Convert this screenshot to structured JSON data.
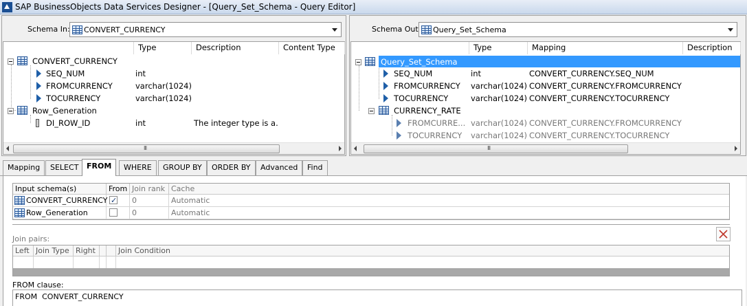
{
  "window": {
    "title": "SAP BusinessObjects Data Services Designer - [Query_Set_Schema - Query Editor]"
  },
  "schema_in": {
    "label": "Schema In:",
    "selected": "CONVERT_CURRENCY",
    "columns": [
      "Type",
      "Description",
      "Content Type"
    ],
    "tree": [
      {
        "name": "CONVERT_CURRENCY",
        "kind": "table",
        "type": "",
        "desc": ""
      },
      {
        "name": "SEQ_NUM",
        "kind": "column",
        "type": "int",
        "desc": ""
      },
      {
        "name": "FROMCURRENCY",
        "kind": "column",
        "type": "varchar(1024)",
        "desc": ""
      },
      {
        "name": "TOCURRENCY",
        "kind": "column",
        "type": "varchar(1024)",
        "desc": ""
      },
      {
        "name": "Row_Generation",
        "kind": "table",
        "type": "",
        "desc": ""
      },
      {
        "name": "DI_ROW_ID",
        "kind": "key",
        "type": "int",
        "desc": "The integer type is a..."
      }
    ]
  },
  "schema_out": {
    "label": "Schema Out:",
    "selected": "Query_Set_Schema",
    "columns": [
      "Type",
      "Mapping",
      "Description"
    ],
    "tree": [
      {
        "name": "Query_Set_Schema",
        "kind": "table",
        "type": "",
        "mapping": ""
      },
      {
        "name": "SEQ_NUM",
        "kind": "column",
        "type": "int",
        "mapping": "CONVERT_CURRENCY.SEQ_NUM"
      },
      {
        "name": "FROMCURRENCY",
        "kind": "column",
        "type": "varchar(1024)",
        "mapping": "CONVERT_CURRENCY.FROMCURRENCY"
      },
      {
        "name": "TOCURRENCY",
        "kind": "column",
        "type": "varchar(1024)",
        "mapping": "CONVERT_CURRENCY.TOCURRENCY"
      },
      {
        "name": "CURRENCY_RATE",
        "kind": "table",
        "type": "",
        "mapping": ""
      },
      {
        "name": "FROMCURRE...",
        "kind": "subcolumn",
        "type": "varchar(1024)",
        "mapping": "CONVERT_CURRENCY.FROMCURRENCY"
      },
      {
        "name": "TOCURRENCY",
        "kind": "subcolumn",
        "type": "varchar(1024)",
        "mapping": "CONVERT_CURRENCY.TOCURRENCY"
      }
    ]
  },
  "tabs": [
    "Mapping",
    "SELECT",
    "FROM",
    "WHERE",
    "GROUP BY",
    "ORDER BY",
    "Advanced",
    "Find"
  ],
  "active_tab": "FROM",
  "input_schemas": {
    "headers": [
      "Input schema(s)",
      "From",
      "Join rank",
      "Cache"
    ],
    "rows": [
      {
        "name": "CONVERT_CURRENCY",
        "from": true,
        "rank": "0",
        "cache": "Automatic"
      },
      {
        "name": "Row_Generation",
        "from": false,
        "rank": "0",
        "cache": "Automatic"
      }
    ]
  },
  "join_pairs": {
    "label": "Join pairs:",
    "headers": [
      "Left",
      "Join Type",
      "Right",
      "",
      "",
      "Join Condition"
    ]
  },
  "from_clause": {
    "label": "FROM clause:",
    "text": "FROM  CONVERT_CURRENCY"
  },
  "colors": {
    "selection": "#3399ff",
    "tree_icon": "#1f5fa8",
    "delete_icon": "#c0392b"
  },
  "icons": [
    "app-icon",
    "table-icon",
    "column-arrow-icon",
    "key-column-icon",
    "dropdown-arrow-icon",
    "delete-icon"
  ]
}
